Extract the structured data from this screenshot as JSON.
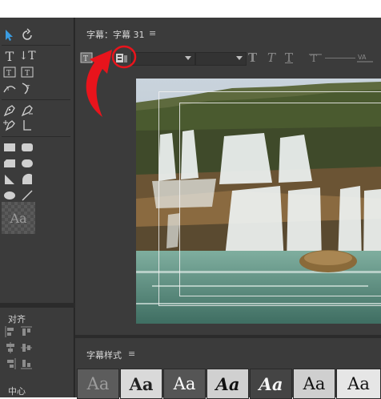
{
  "caption_panel": {
    "title": "字幕：字幕 31",
    "menu_icon": "≡"
  },
  "caption_styles_panel": {
    "title": "字幕样式",
    "menu_icon": "≡",
    "swatches": [
      "Aa",
      "Aa",
      "Aa",
      "Aa",
      "Aa",
      "Aa",
      "Aa"
    ]
  },
  "tools_panel": {
    "style_preview_label": "Aa"
  },
  "align_panel": {
    "title": "对齐",
    "center_label": "中心"
  },
  "annotation": {
    "color": "#e8141c"
  }
}
